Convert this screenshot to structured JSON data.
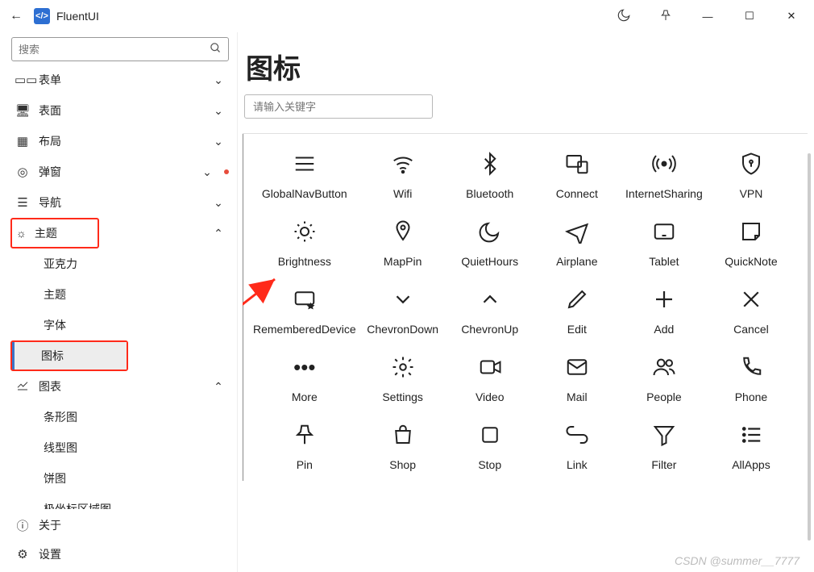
{
  "titlebar": {
    "back_icon": "←",
    "app_logo": "</>",
    "title": "FluentUI",
    "moon_icon": "☾",
    "pin_icon": "📌",
    "minimize_icon": "—",
    "maximize_icon": "☐",
    "close_icon": "✕"
  },
  "sidebar": {
    "search_placeholder": "搜索",
    "items": {
      "form": "表单",
      "surface": "表面",
      "layout": "布局",
      "popup": "弹窗",
      "nav": "导航",
      "theme": "主题",
      "theme_children": {
        "acrylic": "亚克力",
        "theme": "主题",
        "font": "字体",
        "icon": "图标"
      },
      "chart": "图表",
      "chart_children": {
        "bar": "条形图",
        "line": "线型图",
        "pie": "饼图",
        "polar": "极坐标区域图"
      }
    },
    "footer": {
      "about": "关于",
      "settings": "设置"
    }
  },
  "content": {
    "title": "图标",
    "filter_placeholder": "请输入关键字"
  },
  "icons": [
    {
      "name": "GlobalNavButton"
    },
    {
      "name": "Wifi"
    },
    {
      "name": "Bluetooth"
    },
    {
      "name": "Connect"
    },
    {
      "name": "InternetSharing"
    },
    {
      "name": "VPN"
    },
    {
      "name": "Brightness"
    },
    {
      "name": "MapPin"
    },
    {
      "name": "QuietHours"
    },
    {
      "name": "Airplane"
    },
    {
      "name": "Tablet"
    },
    {
      "name": "QuickNote"
    },
    {
      "name": "RememberedDevice"
    },
    {
      "name": "ChevronDown"
    },
    {
      "name": "ChevronUp"
    },
    {
      "name": "Edit"
    },
    {
      "name": "Add"
    },
    {
      "name": "Cancel"
    },
    {
      "name": "More"
    },
    {
      "name": "Settings"
    },
    {
      "name": "Video"
    },
    {
      "name": "Mail"
    },
    {
      "name": "People"
    },
    {
      "name": "Phone"
    },
    {
      "name": "Pin"
    },
    {
      "name": "Shop"
    },
    {
      "name": "Stop"
    },
    {
      "name": "Link"
    },
    {
      "name": "Filter"
    },
    {
      "name": "AllApps"
    }
  ],
  "watermark": "CSDN @summer__7777"
}
